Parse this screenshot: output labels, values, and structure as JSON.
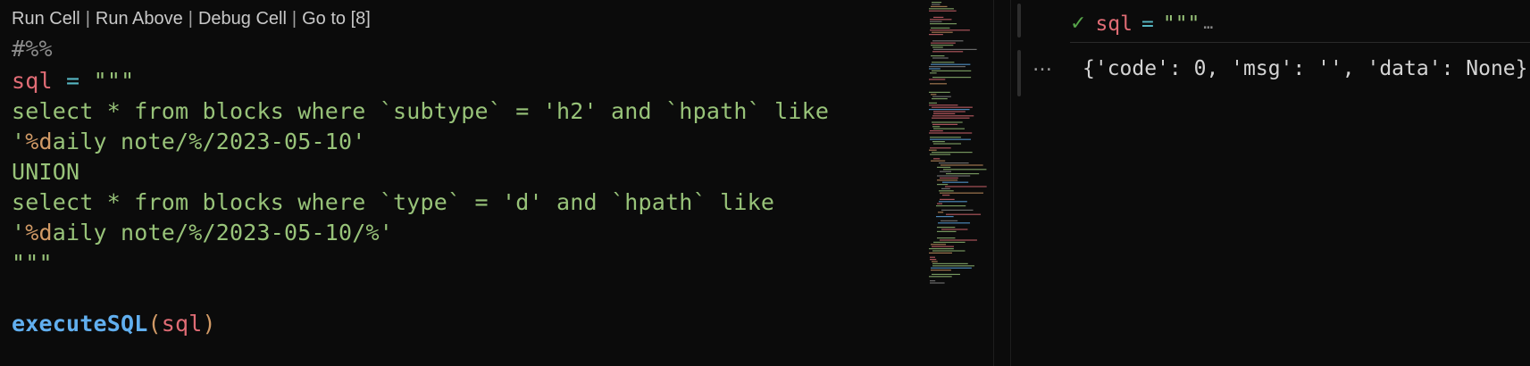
{
  "codelens": {
    "run_cell": "Run Cell",
    "run_above": "Run Above",
    "debug_cell": "Debug Cell",
    "go_to": "Go to [8]",
    "separator": "|"
  },
  "code": {
    "cell_marker": "#%%",
    "assign_var": "sql",
    "assign_op": "=",
    "triple_quote": "\"\"\"",
    "line_select1": "select * from blocks where `subtype` = 'h2' and `hpath` like",
    "line_path1_quote": "'",
    "line_path1_fmt": "%d",
    "line_path1_rest": "aily note/%/2023-05-10'",
    "line_union": "UNION",
    "line_select2": "select * from blocks where `type` = 'd' and `hpath` like",
    "line_path2_quote": "'",
    "line_path2_fmt": "%d",
    "line_path2_rest": "aily note/%/2023-05-10/%'",
    "call_func": "executeSQL",
    "call_open": "(",
    "call_arg": "sql",
    "call_close": ")"
  },
  "output": {
    "header_var": "sql",
    "header_op": "=",
    "header_quote": "\"\"\"",
    "header_ellipsis": "…",
    "check_icon": "✓",
    "more_icon": "…",
    "result_text": "{'code': 0, 'msg': '', 'data': None}"
  },
  "colors": {
    "background": "#0b0b0b",
    "string": "#98c379",
    "variable": "#e06c75",
    "operator": "#56b6c2",
    "function": "#61afef",
    "format": "#d19a66",
    "success": "#57a64a"
  }
}
